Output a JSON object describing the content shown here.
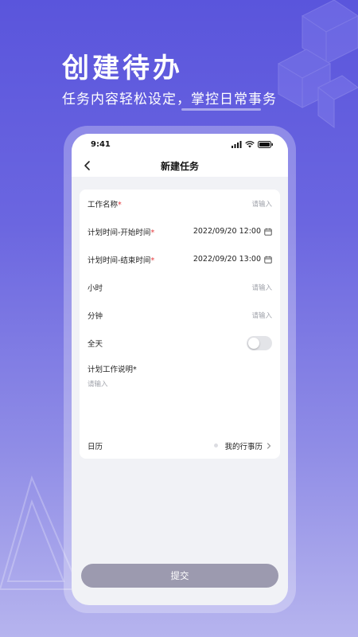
{
  "hero": {
    "title": "创建待办",
    "subtitle": "任务内容轻松设定，掌控日常事务"
  },
  "phone": {
    "status": {
      "time": "9:41",
      "icons": [
        "signal-icon",
        "wifi-icon",
        "battery-icon"
      ]
    },
    "nav": {
      "back_icon": "chevron-left-icon",
      "title": "新建任务"
    },
    "form": {
      "task_name": {
        "label": "工作名称",
        "required_mark": "*",
        "placeholder": "请输入"
      },
      "start_time": {
        "label": "计划时间-开始时间",
        "required_mark": "*",
        "value": "2022/09/20 12:00",
        "icon": "calendar-icon"
      },
      "end_time": {
        "label": "计划时间-结束时间",
        "required_mark": "*",
        "value": "2022/09/20 13:00",
        "icon": "calendar-icon"
      },
      "hours": {
        "label": "小时",
        "placeholder": "请输入"
      },
      "minutes": {
        "label": "分钟",
        "placeholder": "请输入"
      },
      "all_day": {
        "label": "全天",
        "on": false
      },
      "description": {
        "label": "计划工作说明",
        "required_mark": "*",
        "placeholder": "请输入"
      },
      "calendar": {
        "label": "日历",
        "value": "我的行事历",
        "icon": "chevron-right-icon"
      }
    },
    "submit_label": "提交"
  },
  "colors": {
    "background_top": "#5a55dc",
    "background_bottom": "#b6b4ee",
    "required": "#e5383b",
    "submit_button": "#9c9aaf"
  }
}
